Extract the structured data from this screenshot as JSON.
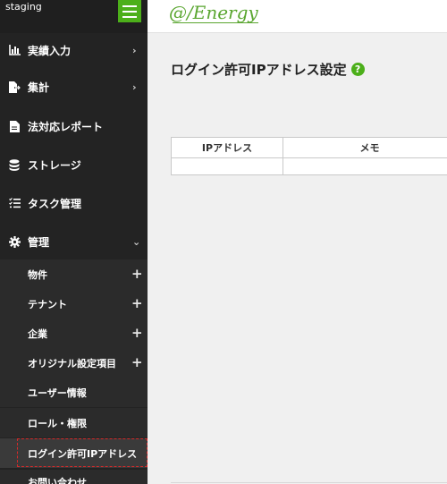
{
  "sidebar": {
    "env_label": "staging",
    "items": [
      {
        "label": "実績入力",
        "icon": "bar-chart-icon",
        "chevron": "›"
      },
      {
        "label": "集計",
        "icon": "export-file-icon",
        "chevron": "›"
      },
      {
        "label": "法対応レポート",
        "icon": "document-icon"
      },
      {
        "label": "ストレージ",
        "icon": "database-icon"
      },
      {
        "label": "タスク管理",
        "icon": "task-list-icon"
      },
      {
        "label": "管理",
        "icon": "gear-icon",
        "chevron": "⌄"
      }
    ],
    "sub_items": [
      {
        "label": "物件",
        "plus": "+"
      },
      {
        "label": "テナント",
        "plus": "+"
      },
      {
        "label": "企業",
        "plus": "+"
      },
      {
        "label": "オリジナル設定項目",
        "plus": "+"
      },
      {
        "label": "ユーザー情報"
      },
      {
        "label": "ロール・権限"
      },
      {
        "label": "ログイン許可IPアドレス"
      },
      {
        "label": "お問い合わせ"
      }
    ]
  },
  "header": {
    "logo_text": "@/Energy"
  },
  "main": {
    "title": "ログイン許可IPアドレス設定",
    "help_icon_glyph": "?",
    "table": {
      "columns": [
        "IPアドレス",
        "メモ"
      ]
    }
  },
  "colors": {
    "accent": "#4caf1a",
    "sidebar_bg": "#232323",
    "active_outline": "#d42a2a"
  }
}
